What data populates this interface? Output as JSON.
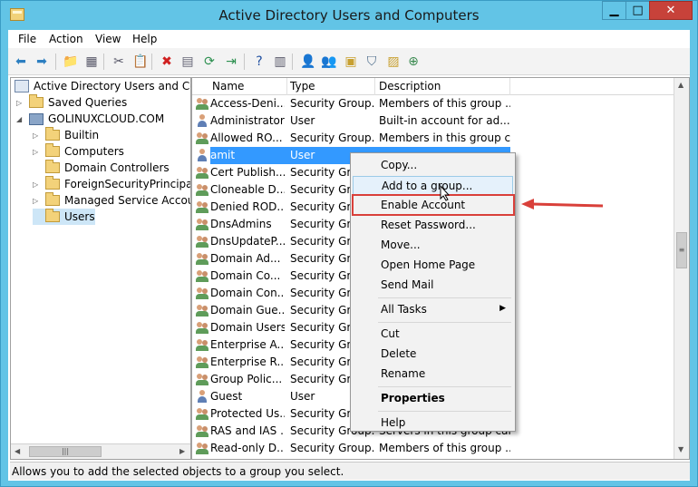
{
  "window": {
    "title": "Active Directory Users and Computers",
    "controls": {
      "minimize": "▁",
      "maximize": "□",
      "close": "✕"
    }
  },
  "menu": [
    "File",
    "Action",
    "View",
    "Help"
  ],
  "toolbar_icons": [
    "back-arrow-icon",
    "forward-arrow-icon",
    "folder-up-icon",
    "console-tree-icon",
    "cut-icon",
    "copy-icon",
    "delete-icon",
    "properties-icon",
    "refresh-icon",
    "export-icon",
    "help-icon",
    "action-pane-icon",
    "new-user-icon",
    "new-group-icon",
    "new-ou-icon",
    "filter-icon",
    "find-icon",
    "add-to-group-icon"
  ],
  "tree": {
    "root": "Active Directory Users and Com",
    "items": [
      {
        "label": "Saved Queries",
        "level": 1,
        "expandable": true
      },
      {
        "label": "GOLINUXCLOUD.COM",
        "level": 1,
        "expandable": true,
        "expanded": true
      },
      {
        "label": "Builtin",
        "level": 2,
        "expandable": true
      },
      {
        "label": "Computers",
        "level": 2,
        "expandable": true
      },
      {
        "label": "Domain Controllers",
        "level": 2,
        "expandable": false
      },
      {
        "label": "ForeignSecurityPrincipals",
        "level": 2,
        "expandable": true
      },
      {
        "label": "Managed Service Accoun",
        "level": 2,
        "expandable": true
      },
      {
        "label": "Users",
        "level": 2,
        "expandable": false,
        "selected": true
      }
    ]
  },
  "list": {
    "columns": [
      "Name",
      "Type",
      "Description"
    ],
    "rows": [
      {
        "name": "Access-Deni...",
        "type": "Security Group...",
        "desc": "Members of this group ...",
        "icon": "group"
      },
      {
        "name": "Administrator",
        "type": "User",
        "desc": "Built-in account for ad...",
        "icon": "user"
      },
      {
        "name": "Allowed RO...",
        "type": "Security Group...",
        "desc": "Members in this group c...",
        "icon": "group"
      },
      {
        "name": "amit",
        "type": "User",
        "desc": "",
        "icon": "user",
        "selected": true
      },
      {
        "name": "Cert Publish...",
        "type": "Security Grou",
        "desc": "",
        "icon": "group"
      },
      {
        "name": "Cloneable D...",
        "type": "Security Grou",
        "desc": "",
        "icon": "group"
      },
      {
        "name": "Denied ROD...",
        "type": "Security Grou",
        "desc": "",
        "icon": "group"
      },
      {
        "name": "DnsAdmins",
        "type": "Security Grou",
        "desc": "",
        "icon": "group"
      },
      {
        "name": "DnsUpdateP...",
        "type": "Security Grou",
        "desc": "",
        "icon": "group"
      },
      {
        "name": "Domain Ad...",
        "type": "Security Grou",
        "desc": "",
        "icon": "group"
      },
      {
        "name": "Domain Co...",
        "type": "Security Grou",
        "desc": "",
        "icon": "group"
      },
      {
        "name": "Domain Con...",
        "type": "Security Grou",
        "desc": "",
        "icon": "group"
      },
      {
        "name": "Domain Gue...",
        "type": "Security Grou",
        "desc": "",
        "icon": "group"
      },
      {
        "name": "Domain Users",
        "type": "Security Grou",
        "desc": "",
        "icon": "group"
      },
      {
        "name": "Enterprise A...",
        "type": "Security Grou",
        "desc": "",
        "icon": "group"
      },
      {
        "name": "Enterprise R...",
        "type": "Security Grou",
        "desc": "",
        "icon": "group"
      },
      {
        "name": "Group Polic...",
        "type": "Security Grou",
        "desc": "",
        "icon": "group"
      },
      {
        "name": "Guest",
        "type": "User",
        "desc": "",
        "icon": "user"
      },
      {
        "name": "Protected Us...",
        "type": "Security Grou",
        "desc": "",
        "icon": "group"
      },
      {
        "name": "RAS and IAS ...",
        "type": "Security Group...",
        "desc": "Servers in this group can...",
        "icon": "group"
      },
      {
        "name": "Read-only D...",
        "type": "Security Group...",
        "desc": "Members of this group ...",
        "icon": "group"
      }
    ]
  },
  "context_menu": {
    "items": [
      {
        "label": "Copy...",
        "bold": false
      },
      {
        "label": "Add to a group...",
        "bold": false,
        "hover": true
      },
      {
        "label": "Enable Account",
        "bold": false,
        "highlighted": true
      },
      {
        "label": "Reset Password...",
        "bold": false
      },
      {
        "label": "Move...",
        "bold": false
      },
      {
        "label": "Open Home Page",
        "bold": false
      },
      {
        "label": "Send Mail",
        "bold": false
      },
      {
        "sep": true
      },
      {
        "label": "All Tasks",
        "bold": false,
        "submenu": true
      },
      {
        "sep": true
      },
      {
        "label": "Cut",
        "bold": false
      },
      {
        "label": "Delete",
        "bold": false
      },
      {
        "label": "Rename",
        "bold": false
      },
      {
        "sep": true
      },
      {
        "label": "Properties",
        "bold": true
      },
      {
        "sep": true
      },
      {
        "label": "Help",
        "bold": false
      }
    ]
  },
  "statusbar": {
    "text": "Allows you to add the selected objects to a group you select."
  },
  "colors": {
    "titlebar": "#62c4e6",
    "selection": "#3399ff",
    "highlight": "#d9403a"
  }
}
